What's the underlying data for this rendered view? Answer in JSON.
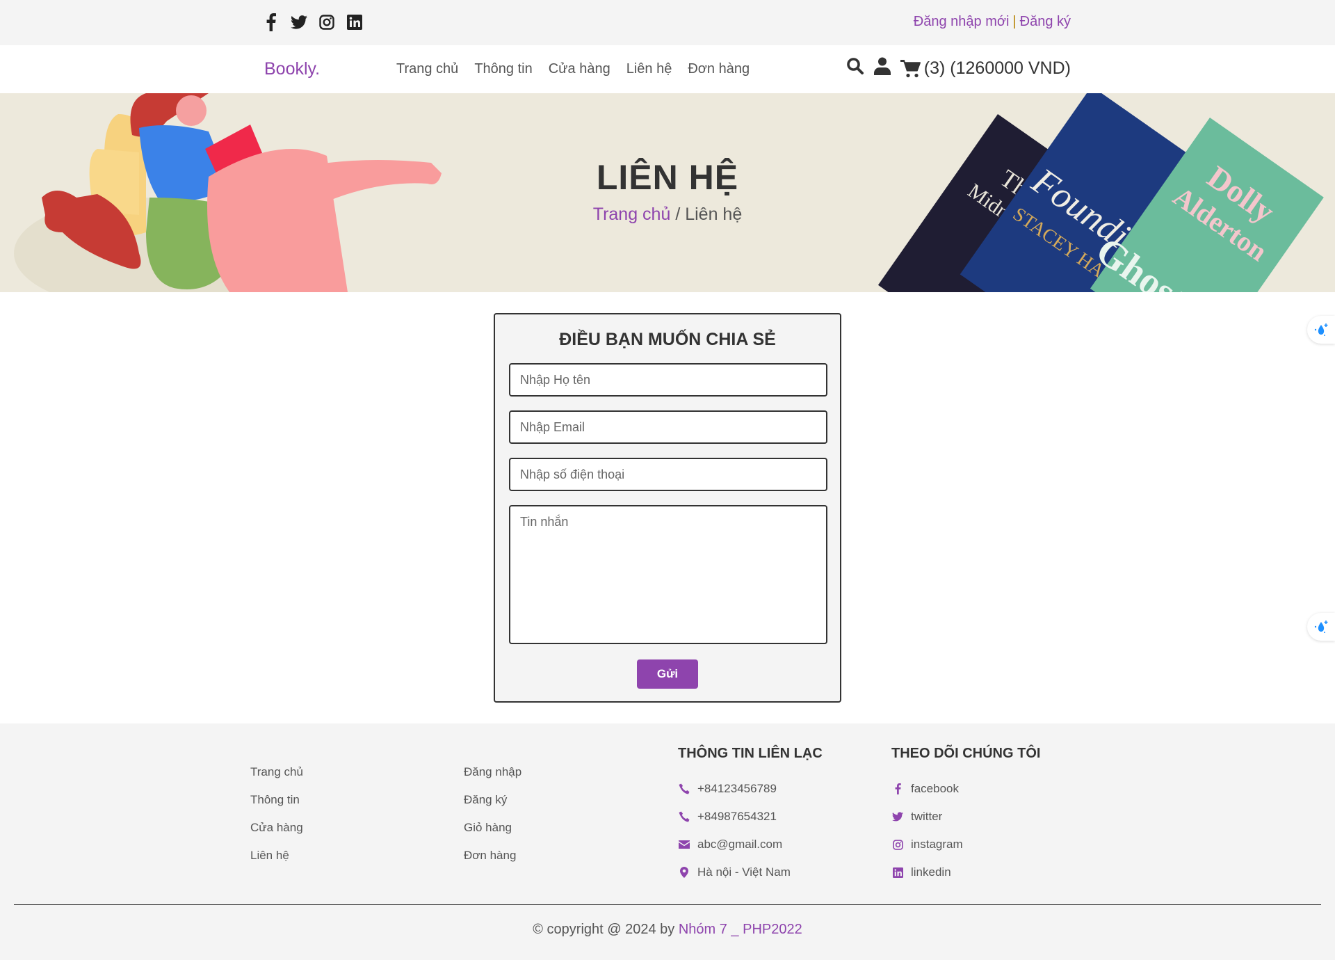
{
  "topbar": {
    "social_icons": [
      "facebook-icon",
      "twitter-icon",
      "instagram-icon",
      "linkedin-icon"
    ],
    "login_label": "Đăng nhập mới",
    "separator": "|",
    "register_label": "Đăng ký"
  },
  "navbar": {
    "logo": "Bookly.",
    "links": [
      "Trang chủ",
      "Thông tin",
      "Cửa hàng",
      "Liên hệ",
      "Đơn hàng"
    ],
    "cart_summary": "(3) (1260000 VND)"
  },
  "banner": {
    "title": "LIÊN HỆ",
    "breadcrumb_home": "Trang chủ",
    "breadcrumb_sep": " / ",
    "breadcrumb_current": "Liên hệ"
  },
  "contact_form": {
    "title": "ĐIỀU BẠN MUỐN CHIA SẺ",
    "name_placeholder": "Nhập Họ tên",
    "email_placeholder": "Nhập Email",
    "phone_placeholder": "Nhập số điện thoại",
    "message_placeholder": "Tin nhắn",
    "submit_label": "Gửi"
  },
  "footer": {
    "col1": [
      "Trang chủ",
      "Thông tin",
      "Cửa hàng",
      "Liên hệ"
    ],
    "col2": [
      "Đăng nhập",
      "Đăng ký",
      "Giỏ hàng",
      "Đơn hàng"
    ],
    "contact_heading": "THÔNG TIN LIÊN LẠC",
    "contact_items": [
      {
        "icon": "phone-icon",
        "text": "+84123456789"
      },
      {
        "icon": "phone-icon",
        "text": "+84987654321"
      },
      {
        "icon": "envelope-icon",
        "text": "abc@gmail.com"
      },
      {
        "icon": "map-pin-icon",
        "text": "Hà nội - Việt Nam"
      }
    ],
    "follow_heading": "THEO DÕI CHÚNG TÔI",
    "follow_items": [
      {
        "icon": "facebook-icon",
        "text": "facebook"
      },
      {
        "icon": "twitter-icon",
        "text": "twitter"
      },
      {
        "icon": "instagram-icon",
        "text": "instagram"
      },
      {
        "icon": "linkedin-icon",
        "text": "linkedin"
      }
    ],
    "copyright_prefix": "© copyright @ 2024 by ",
    "copyright_team": "Nhóm 7 _ PHP2022"
  },
  "colors": {
    "accent": "#8e44ad",
    "text_dark": "#333333",
    "topbar_bg": "#f4f4f4",
    "banner_bg": "#ede9dc"
  }
}
